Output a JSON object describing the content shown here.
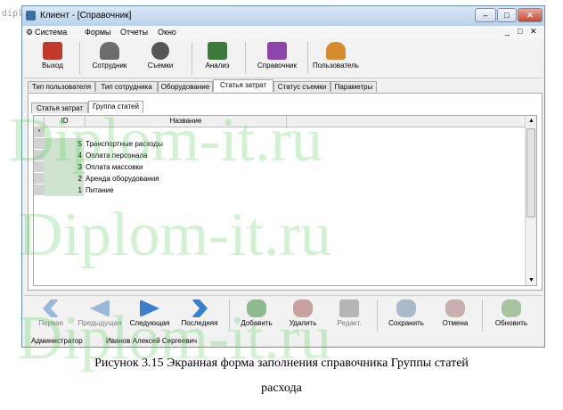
{
  "watermark_small": "diplom-it",
  "window": {
    "title": "Клиент - [Справочник]"
  },
  "titlebar_buttons": [
    "–",
    "□",
    "✕"
  ],
  "menu": {
    "items": [
      "Система",
      "Формы",
      "Отчеты",
      "Окно"
    ],
    "mdi_controls": [
      "_",
      "□",
      "✕"
    ]
  },
  "toolbar": {
    "buttons": [
      {
        "label": "Выход",
        "icon": "exit-icon",
        "color": "#c0392b"
      },
      {
        "label": "Сотрудник",
        "icon": "employee-icon",
        "color": "#6d6d6d"
      },
      {
        "label": "Съемки",
        "icon": "film-icon",
        "color": "#555555"
      },
      {
        "label": "Анализ",
        "icon": "chart-icon",
        "color": "#3c7a3c"
      },
      {
        "label": "Справочник",
        "icon": "folder-icon",
        "color": "#8e44ad"
      },
      {
        "label": "Пользователь",
        "icon": "users-icon",
        "color": "#d68a2e"
      }
    ]
  },
  "tabs_main": [
    "Тип пользователя",
    "Тип сотрудника",
    "Оборудование",
    "Статья затрат",
    "Статус съемки",
    "Параметры"
  ],
  "tabs_main_active": 3,
  "tabs_sub": [
    "Статья затрат",
    "Группа статей"
  ],
  "tabs_sub_active": 1,
  "grid": {
    "columns": [
      "ID",
      "Название"
    ],
    "new_row_marker": "*",
    "rows": [
      {
        "id": "5",
        "name": "Транспортные расходы"
      },
      {
        "id": "4",
        "name": "Оплата персонала"
      },
      {
        "id": "3",
        "name": "Оплата массовки"
      },
      {
        "id": "2",
        "name": "Аренда оборудования"
      },
      {
        "id": "1",
        "name": "Питание"
      }
    ]
  },
  "nav": {
    "buttons": [
      {
        "label": "Первая",
        "icon": "first-icon",
        "enabled": false
      },
      {
        "label": "Предыдущая",
        "icon": "prev-icon",
        "enabled": false
      },
      {
        "label": "Следующая",
        "icon": "next-icon",
        "enabled": true
      },
      {
        "label": "Последняя",
        "icon": "last-icon",
        "enabled": true
      },
      {
        "label": "Добавить",
        "icon": "db-add-icon",
        "enabled": true
      },
      {
        "label": "Удалить",
        "icon": "db-delete-icon",
        "enabled": true
      },
      {
        "label": "Редакт.",
        "icon": "edit-icon",
        "enabled": false
      },
      {
        "label": "Сохранить",
        "icon": "save-icon",
        "enabled": true
      },
      {
        "label": "Отмена",
        "icon": "cancel-icon",
        "enabled": true
      },
      {
        "label": "Обновить",
        "icon": "refresh-icon",
        "enabled": true
      }
    ]
  },
  "status": {
    "role": "Администратор",
    "user": "Иванов Алексей Сергеевич"
  },
  "caption": {
    "line1": "Рисунок 3.15 Экранная форма заполнения справочника Группы статей",
    "line2": "расхода"
  },
  "watermark_big": "Diplom-it.ru"
}
